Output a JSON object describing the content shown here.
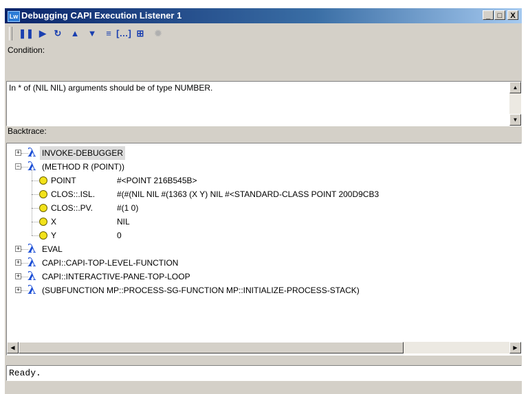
{
  "window": {
    "title": "Debugging CAPI Execution Listener 1",
    "icon": "lw-icon",
    "icon_text": "Lw"
  },
  "window_controls": {
    "minimize": "_",
    "maximize": "□",
    "close": "X"
  },
  "toolbar": [
    {
      "name": "pause-icon",
      "glyph": "❚❚",
      "enabled": true
    },
    {
      "name": "step-icon",
      "glyph": "▶",
      "enabled": true
    },
    {
      "name": "restart-icon",
      "glyph": "↻",
      "enabled": true
    },
    {
      "name": "up-frame-icon",
      "glyph": "▲",
      "enabled": true
    },
    {
      "name": "down-frame-icon",
      "glyph": "▼",
      "enabled": true
    },
    {
      "name": "frame-list-icon",
      "glyph": "≡",
      "enabled": true
    },
    {
      "name": "variables-icon",
      "glyph": "[…]",
      "enabled": true
    },
    {
      "name": "source-icon",
      "glyph": "⊞",
      "enabled": true
    },
    {
      "name": "bug-icon",
      "glyph": "✹",
      "enabled": false
    }
  ],
  "condition": {
    "label": "Condition:",
    "text": "In * of (NIL NIL) arguments should be of type NUMBER."
  },
  "backtrace": {
    "label": "Backtrace:",
    "frames": [
      {
        "label": "INVOKE-DEBUGGER",
        "expanded": false,
        "selected": true
      },
      {
        "label": "(METHOD R (POINT))",
        "expanded": true,
        "selected": false,
        "variables": [
          {
            "name": "POINT",
            "value": "#<POINT 216B545B>"
          },
          {
            "name": "CLOS::.ISL.",
            "value": "#(#(NIL NIL #(1363 (X Y) NIL #<STANDARD-CLASS POINT 200D9CB3"
          },
          {
            "name": "CLOS::.PV.",
            "value": "#(1 0)"
          },
          {
            "name": "X",
            "value": "NIL"
          },
          {
            "name": "Y",
            "value": "0"
          }
        ]
      },
      {
        "label": "EVAL",
        "expanded": false,
        "selected": false
      },
      {
        "label": "CAPI::CAPI-TOP-LEVEL-FUNCTION",
        "expanded": false,
        "selected": false
      },
      {
        "label": "CAPI::INTERACTIVE-PANE-TOP-LOOP",
        "expanded": false,
        "selected": false
      },
      {
        "label": "(SUBFUNCTION MP::PROCESS-SG-FUNCTION MP::INITIALIZE-PROCESS-STACK)",
        "expanded": false,
        "selected": false
      }
    ]
  },
  "status": {
    "text": "Ready."
  }
}
